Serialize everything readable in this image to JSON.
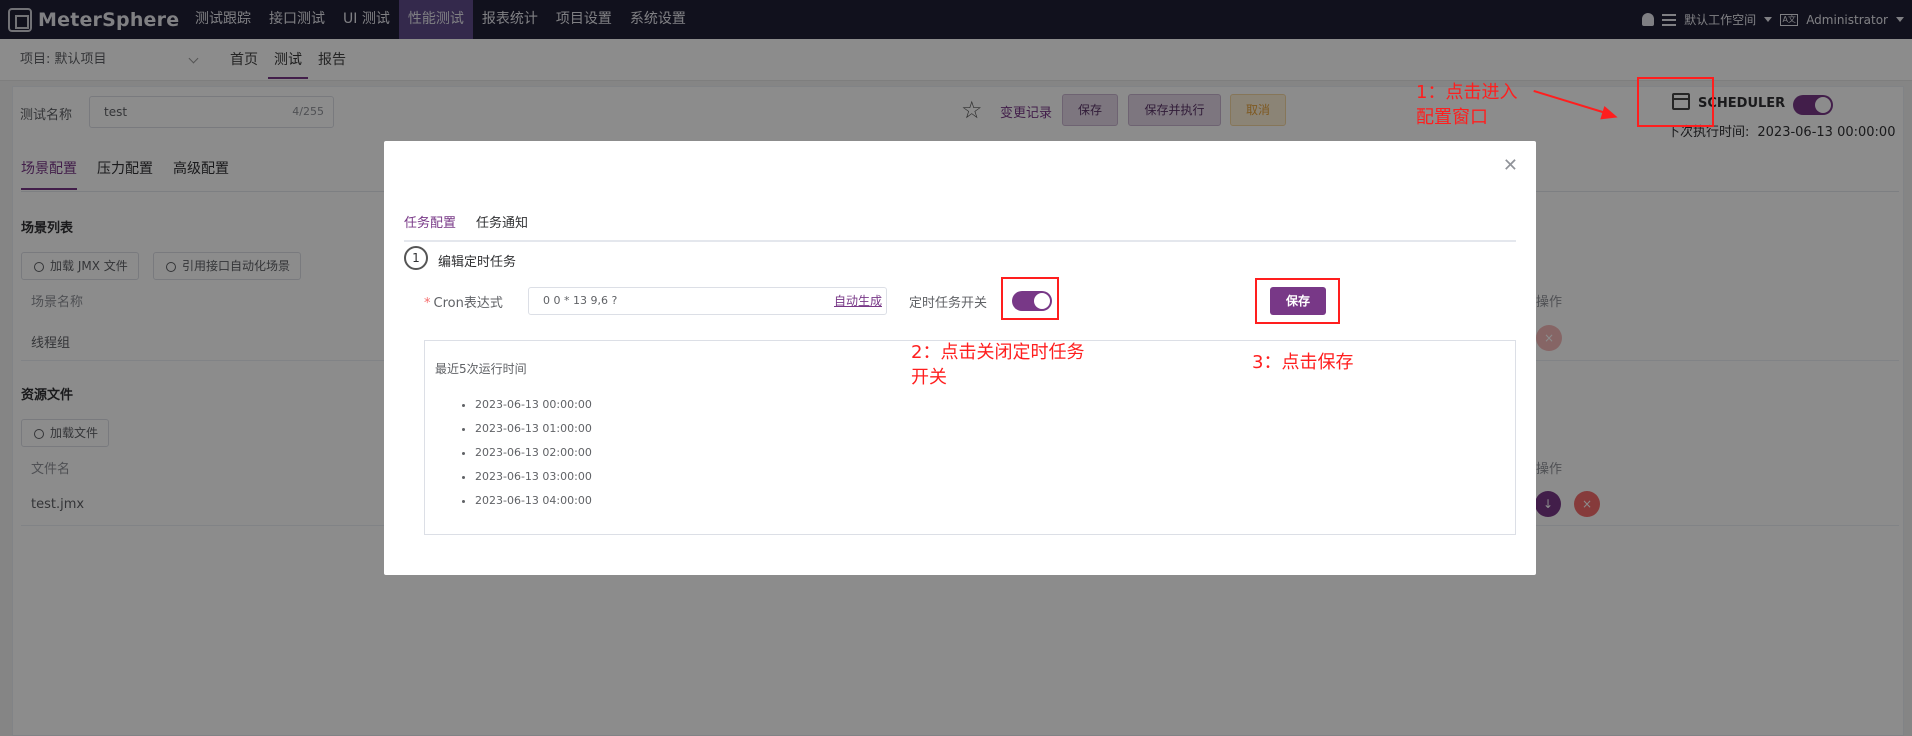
{
  "app": {
    "name": "MeterSphere"
  },
  "nav": {
    "items": [
      "测试跟踪",
      "接口测试",
      "UI 测试",
      "性能测试",
      "报表统计",
      "项目设置",
      "系统设置"
    ],
    "active": "性能测试",
    "workspace": "默认工作空间",
    "user": "Administrator",
    "lang_icon": "A文"
  },
  "subheader": {
    "project": "项目: 默认项目",
    "tabs": [
      "首页",
      "测试",
      "报告"
    ],
    "active_tab": "测试"
  },
  "test": {
    "name_label": "测试名称",
    "name_value": "test",
    "name_count": "4/255",
    "changes": "变更记录",
    "save": "保存",
    "save_run": "保存并执行",
    "cancel": "取消",
    "scheduler_label": "SCHEDULER",
    "next_run_label": "下次执行时间:",
    "next_run_value": "2023-06-13 00:00:00"
  },
  "config_tabs": [
    "场景配置",
    "压力配置",
    "高级配置"
  ],
  "scenario": {
    "title": "场景列表",
    "load_jmx": "加载 JMX 文件",
    "ref_api": "引用接口自动化场景",
    "col_name": "场景名称",
    "col_ops": "操作",
    "row_name": "线程组"
  },
  "resources": {
    "title": "资源文件",
    "load_file": "加载文件",
    "col_name": "文件名",
    "col_ops": "操作",
    "row_name": "test.jmx"
  },
  "dialog": {
    "tabs": [
      "任务配置",
      "任务通知"
    ],
    "active_tab": "任务配置",
    "step_num": "1",
    "step_text": "编辑定时任务",
    "cron_required": "*",
    "cron_label": "Cron表达式",
    "cron_value": "0 0 * 13 9,6 ?",
    "cron_auto": "自动生成",
    "timer_label": "定时任务开关",
    "timer_on": true,
    "save": "保存",
    "runs_title": "最近5次运行时间",
    "runs": [
      "2023-06-13 00:00:00",
      "2023-06-13 01:00:00",
      "2023-06-13 02:00:00",
      "2023-06-13 03:00:00",
      "2023-06-13 04:00:00"
    ]
  },
  "annotations": {
    "a1_line1": "1：点击进入",
    "a1_line2": "配置窗口",
    "a2_line1": "2：点击关闭定时任务",
    "a2_line2": "开关",
    "a3": "3：点击保存"
  },
  "colors": {
    "brand": "#783887",
    "nav_bg": "#1f1f35",
    "annotation": "#ff1e1e"
  }
}
